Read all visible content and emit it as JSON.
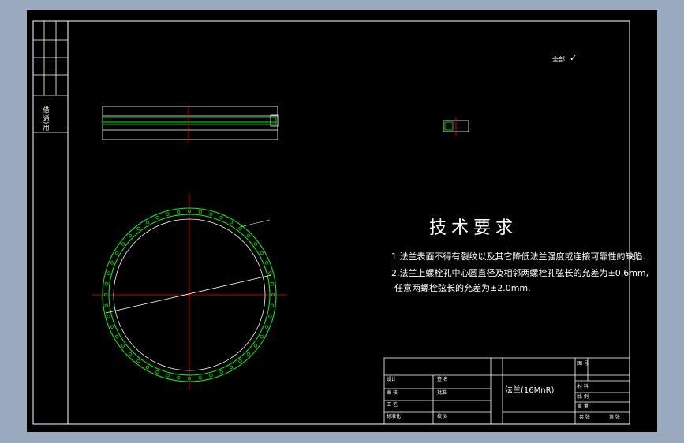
{
  "drawing": {
    "surface_mark": "全部",
    "tech_title": "技术要求",
    "requirements": [
      "1.法兰表面不得有裂纹以及其它降低法兰强度或连接可靠性的缺陷.",
      "2.法兰上螺栓孔中心圆直径及相邻两螺栓孔弦长的允差为±0.6mm,",
      "任意两螺栓弦长的允差为±2.0mm."
    ],
    "part_name": "法兰(16MnR)",
    "side_label": "借(通)用",
    "title_block_left": [
      "设计",
      "审 核",
      "工 艺",
      "标准化",
      "日 期"
    ],
    "title_block_left_b": [
      "签 名",
      "批准",
      "校 对"
    ],
    "title_block_small": [
      "图 号",
      "材 料",
      "比 例",
      "重 量",
      "共 张",
      "第 张"
    ]
  },
  "colors": {
    "background": "#000000",
    "outer": "#9aa9bd",
    "line": "#ffffff",
    "bolt": "#00ff00",
    "center": "#ff0000",
    "dim": "#ffffff"
  }
}
